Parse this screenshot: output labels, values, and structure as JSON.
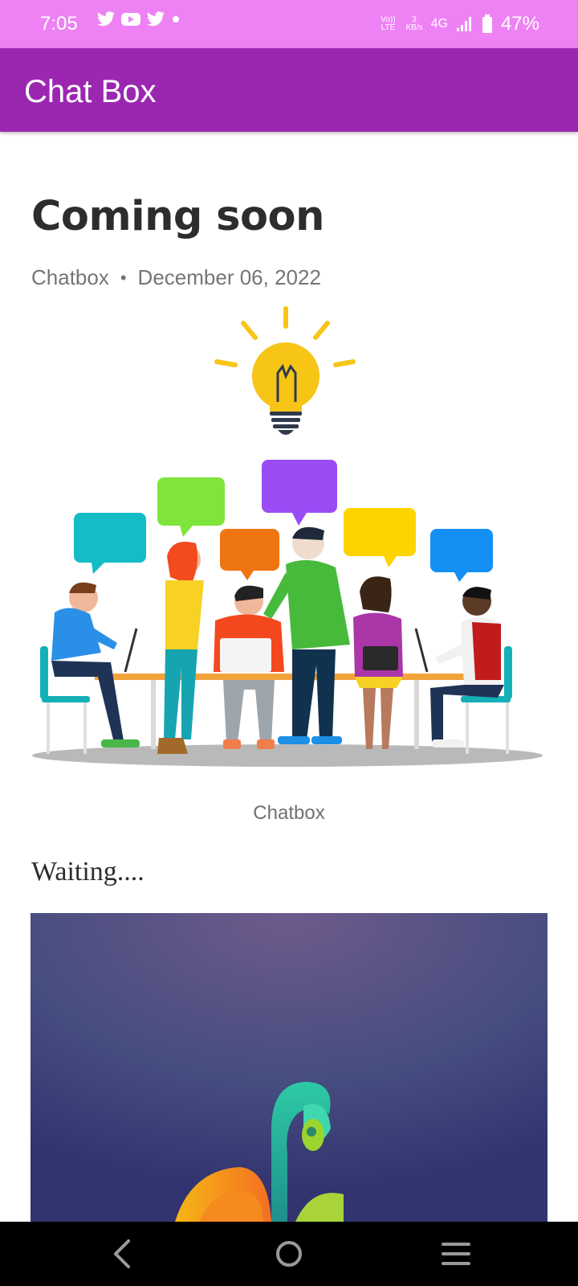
{
  "status_bar": {
    "time": "7:05",
    "notification_icons": [
      "twitter-icon",
      "youtube-icon",
      "twitter-icon",
      "dot-icon"
    ],
    "volte": "Vo)) LTE",
    "speed_value": "3",
    "speed_unit": "KB/s",
    "network": "4G",
    "battery": "47%"
  },
  "app_bar": {
    "title": "Chat Box"
  },
  "post": {
    "title": "Coming soon",
    "author": "Chatbox",
    "separator": "•",
    "date": "December 06, 2022",
    "image_caption": "Chatbox",
    "body": "Waiting...."
  },
  "nav_bar": {
    "icons": [
      "back-icon",
      "home-icon",
      "menu-icon"
    ]
  },
  "colors": {
    "status_bar": "#ee82f4",
    "app_bar": "#9b27b1",
    "title_text": "#2d2d2d",
    "meta_text": "#757575"
  }
}
